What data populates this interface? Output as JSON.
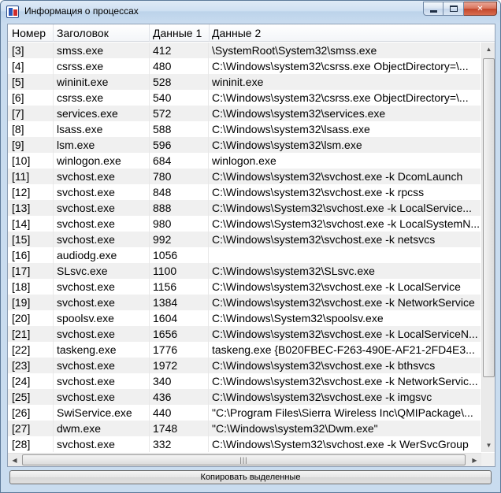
{
  "window": {
    "title": "Информация о процессах"
  },
  "columns": [
    "Номер",
    "Заголовок",
    "Данные 1",
    "Данные 2"
  ],
  "rows": [
    [
      "[3]",
      "smss.exe",
      "412",
      "\\SystemRoot\\System32\\smss.exe"
    ],
    [
      "[4]",
      "csrss.exe",
      "480",
      "C:\\Windows\\system32\\csrss.exe ObjectDirectory=\\..."
    ],
    [
      "[5]",
      "wininit.exe",
      "528",
      "wininit.exe"
    ],
    [
      "[6]",
      "csrss.exe",
      "540",
      "C:\\Windows\\system32\\csrss.exe ObjectDirectory=\\..."
    ],
    [
      "[7]",
      "services.exe",
      "572",
      "C:\\Windows\\system32\\services.exe"
    ],
    [
      "[8]",
      "lsass.exe",
      "588",
      "C:\\Windows\\system32\\lsass.exe"
    ],
    [
      "[9]",
      "lsm.exe",
      "596",
      "C:\\Windows\\system32\\lsm.exe"
    ],
    [
      "[10]",
      "winlogon.exe",
      "684",
      "winlogon.exe"
    ],
    [
      "[11]",
      "svchost.exe",
      "780",
      "C:\\Windows\\system32\\svchost.exe -k DcomLaunch"
    ],
    [
      "[12]",
      "svchost.exe",
      "848",
      "C:\\Windows\\system32\\svchost.exe -k rpcss"
    ],
    [
      "[13]",
      "svchost.exe",
      "888",
      "C:\\Windows\\System32\\svchost.exe -k LocalService..."
    ],
    [
      "[14]",
      "svchost.exe",
      "980",
      "C:\\Windows\\System32\\svchost.exe -k LocalSystemN..."
    ],
    [
      "[15]",
      "svchost.exe",
      "992",
      "C:\\Windows\\system32\\svchost.exe -k netsvcs"
    ],
    [
      "[16]",
      "audiodg.exe",
      "1056",
      ""
    ],
    [
      "[17]",
      "SLsvc.exe",
      "1100",
      "C:\\Windows\\system32\\SLsvc.exe"
    ],
    [
      "[18]",
      "svchost.exe",
      "1156",
      "C:\\Windows\\system32\\svchost.exe -k LocalService"
    ],
    [
      "[19]",
      "svchost.exe",
      "1384",
      "C:\\Windows\\system32\\svchost.exe -k NetworkService"
    ],
    [
      "[20]",
      "spoolsv.exe",
      "1604",
      "C:\\Windows\\System32\\spoolsv.exe"
    ],
    [
      "[21]",
      "svchost.exe",
      "1656",
      "C:\\Windows\\system32\\svchost.exe -k LocalServiceN..."
    ],
    [
      "[22]",
      "taskeng.exe",
      "1776",
      "taskeng.exe {B020FBEC-F263-490E-AF21-2FD4E3..."
    ],
    [
      "[23]",
      "svchost.exe",
      "1972",
      "C:\\Windows\\system32\\svchost.exe -k bthsvcs"
    ],
    [
      "[24]",
      "svchost.exe",
      "340",
      "C:\\Windows\\system32\\svchost.exe -k NetworkServic..."
    ],
    [
      "[25]",
      "svchost.exe",
      "436",
      "C:\\Windows\\system32\\svchost.exe -k imgsvc"
    ],
    [
      "[26]",
      "SwiService.exe",
      "440",
      "\"C:\\Program Files\\Sierra Wireless Inc\\QMIPackage\\..."
    ],
    [
      "[27]",
      "dwm.exe",
      "1748",
      "\"C:\\Windows\\system32\\Dwm.exe\""
    ],
    [
      "[28]",
      "svchost.exe",
      "332",
      "C:\\Windows\\System32\\svchost.exe -k WerSvcGroup"
    ]
  ],
  "copy_button": {
    "label": "Копировать выделенные"
  },
  "icons": {
    "app": "app-icon",
    "minimize": "minimize-icon",
    "maximize": "maximize-icon",
    "close": "close-icon"
  }
}
